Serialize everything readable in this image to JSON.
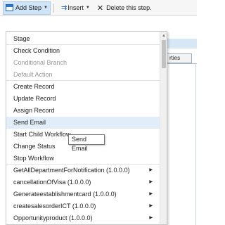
{
  "toolbar": {
    "add_step": "Add Step",
    "insert": "Insert",
    "delete": "Delete this step."
  },
  "background": {
    "tab_label": "rties"
  },
  "menu": {
    "items": [
      {
        "label": "Stage",
        "state": "normal"
      },
      {
        "label": "Check Condition",
        "state": "normal"
      },
      {
        "label": "Conditional Branch",
        "state": "disabled"
      },
      {
        "label": "Default Action",
        "state": "disabled"
      },
      {
        "label": "Create Record",
        "state": "normal"
      },
      {
        "label": "Update Record",
        "state": "normal"
      },
      {
        "label": "Assign Record",
        "state": "normal"
      },
      {
        "label": "Send Email",
        "state": "hover"
      },
      {
        "label": "Start Child Workflow",
        "state": "normal"
      },
      {
        "label": "Change Status",
        "state": "normal"
      },
      {
        "label": "Stop Workflow",
        "state": "normal"
      },
      {
        "label": "GetAllDepartmentForNotification (1.0.0.0)",
        "state": "submenu"
      },
      {
        "label": "cancellationOfVisa (1.0.0.0)",
        "state": "submenu"
      },
      {
        "label": "Generateestablishmentcard (1.0.0.0)",
        "state": "submenu"
      },
      {
        "label": "createsalesorderICT (1.0.0.0)",
        "state": "submenu"
      },
      {
        "label": "Opportunityproduct (1.0.0.0)",
        "state": "submenu"
      }
    ]
  },
  "tooltip": {
    "text": "Send Email"
  },
  "icons": {
    "add_step": "add-step-icon",
    "insert": "insert-icon",
    "delete": "delete-x-icon",
    "submenu": "chevron-right-icon",
    "caret": "caret-down-icon"
  },
  "colors": {
    "active_button_bg": "#cfe4f7",
    "hover_row_bg": "#e1eef9",
    "disabled_text": "#9a9a9a"
  }
}
